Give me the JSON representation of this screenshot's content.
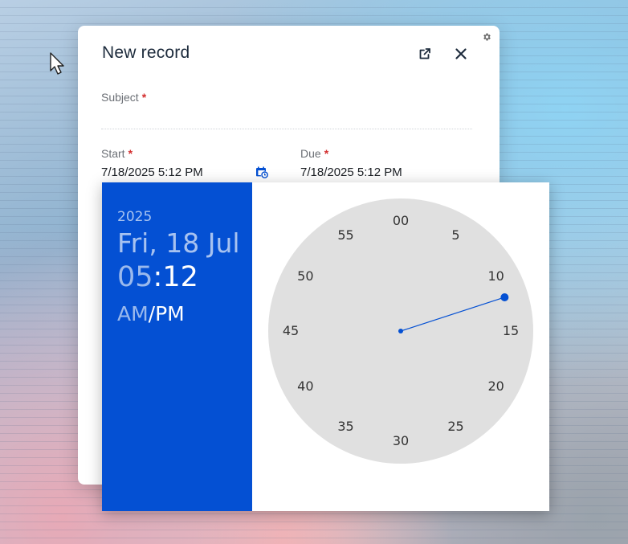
{
  "dialog": {
    "title": "New record",
    "required_mark": "*",
    "subject": {
      "label": "Subject",
      "value": ""
    },
    "start": {
      "label": "Start",
      "value": "7/18/2025 5:12 PM"
    },
    "due": {
      "label": "Due",
      "value": "7/18/2025 5:12 PM"
    }
  },
  "picker": {
    "year": "2025",
    "date": "Fri, 18 Jul",
    "hour": "05",
    "separator": ":",
    "minute": "12",
    "am": "AM",
    "ampm_sep": "/",
    "pm": "PM",
    "clock_numbers": [
      "00",
      "5",
      "10",
      "15",
      "20",
      "25",
      "30",
      "35",
      "40",
      "45",
      "50",
      "55"
    ],
    "selected_minute": 12
  },
  "colors": {
    "accent": "#0450d3",
    "clock_face": "#e0e0e0",
    "required": "#d32f2f"
  },
  "icons": {
    "gear": "gear-icon",
    "open_external": "external-link-icon",
    "close": "close-icon",
    "calendar": "calendar-clock-icon",
    "cursor": "mouse-cursor-icon"
  }
}
